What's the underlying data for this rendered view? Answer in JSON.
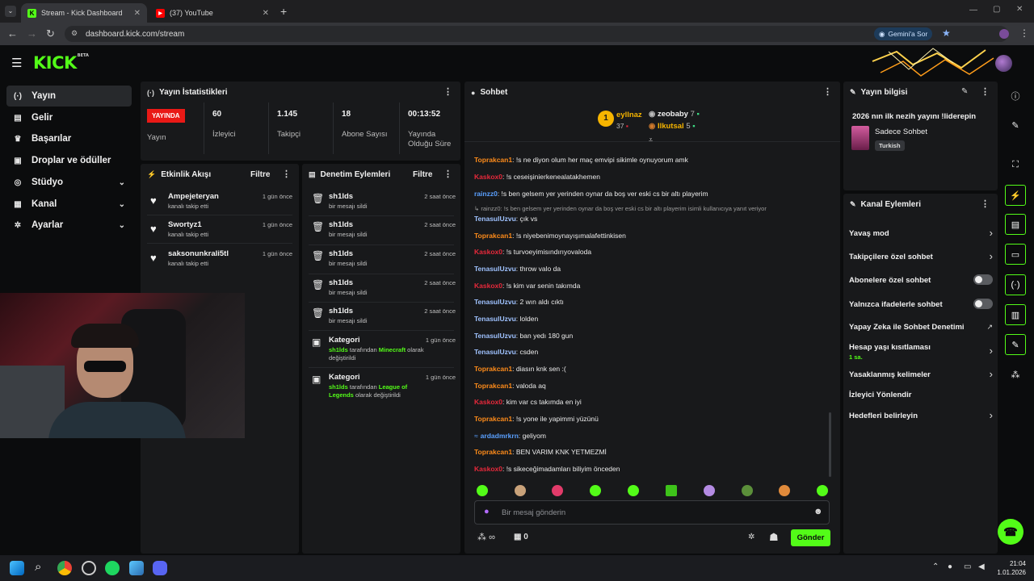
{
  "browser": {
    "tabs": [
      {
        "title": "Stream - Kick Dashboard"
      },
      {
        "title": "(37) YouTube"
      }
    ],
    "url": "dashboard.kick.com/stream",
    "gemini_label": "Gemini'a Sor"
  },
  "header": {
    "logo": "KICK",
    "logo_badge": "BETA"
  },
  "nav": {
    "items": [
      {
        "label": "Yayın",
        "icon": "broadcast-icon",
        "glyph": "(·)"
      },
      {
        "label": "Gelir",
        "icon": "revenue-icon",
        "glyph": "▤"
      },
      {
        "label": "Başarılar",
        "icon": "trophy-icon",
        "glyph": "♛"
      },
      {
        "label": "Droplar ve ödüller",
        "icon": "gift-icon",
        "glyph": "▣"
      },
      {
        "label": "Stüdyo",
        "icon": "studio-icon",
        "glyph": "◎"
      },
      {
        "label": "Kanal",
        "icon": "channel-icon",
        "glyph": "▦"
      },
      {
        "label": "Ayarlar",
        "icon": "settings-icon",
        "glyph": "✲"
      }
    ]
  },
  "stats": {
    "title": "Yayın İstatistikleri",
    "live_badge": "YAYINDA",
    "live_label": "Yayın",
    "items": [
      {
        "value": "60",
        "label": "İzleyici"
      },
      {
        "value": "1.145",
        "label": "Takipçi"
      },
      {
        "value": "18",
        "label": "Abone Sayısı"
      },
      {
        "value": "00:13:52",
        "label": "Yayında Olduğu Süre"
      }
    ]
  },
  "activity": {
    "title": "Etkinlik Akışı",
    "filter": "Filtre",
    "items": [
      {
        "name": "Ampejeteryan",
        "sub": "kanalı takip etti",
        "time": "1 gün önce"
      },
      {
        "name": "Swortyz1",
        "sub": "kanalı takip etti",
        "time": "1 gün önce"
      },
      {
        "name": "saksonunkrali5tl",
        "sub": "kanalı takip etti",
        "time": "1 gün önce"
      }
    ]
  },
  "moderation": {
    "title": "Denetim Eylemleri",
    "filter": "Filtre",
    "items": [
      {
        "name": "sh1lds",
        "sub": "bir mesajı sildi",
        "time": "2 saat önce"
      },
      {
        "name": "sh1lds",
        "sub": "bir mesajı sildi",
        "time": "2 saat önce"
      },
      {
        "name": "sh1lds",
        "sub": "bir mesajı sildi",
        "time": "2 saat önce"
      },
      {
        "name": "sh1lds",
        "sub": "bir mesajı sildi",
        "time": "2 saat önce"
      },
      {
        "name": "sh1lds",
        "sub": "bir mesajı sildi",
        "time": "2 saat önce"
      }
    ],
    "category_items": [
      {
        "name": "Kategori",
        "user": "sh1lds",
        "mid": "tarafından",
        "game": "Minecraft",
        "tail": "olarak değiştirildi",
        "time": "1 gün önce"
      },
      {
        "name": "Kategori",
        "user": "sh1lds",
        "mid": "tarafından",
        "game": "League of Legends",
        "tail": "olarak değiştirildi",
        "time": "1 gün önce"
      }
    ]
  },
  "chat": {
    "title": "Sohbet",
    "leaderboard": {
      "first": {
        "rank": "1",
        "name": "eyllnaz",
        "count": "37"
      },
      "second": {
        "name": "zeobaby",
        "count": "7"
      },
      "third": {
        "name": "Ilkutsal",
        "count": "5"
      }
    },
    "messages": [
      {
        "user": "Toprakcan1",
        "text": ": !s ne diyon olum her maç emvipi sikimle oynuyorum amk",
        "color": "#ff8c1a"
      },
      {
        "user": "Kaskox0",
        "text": ": !s ceseişinierkenealatakhemen",
        "color": "#e8293b"
      },
      {
        "user": "rainzz0",
        "text": ": !s ben gelsem yer yerinden oynar da boş ver eski cs bir altı playerim",
        "color": "#5aa0ff"
      },
      {
        "user": "TenasulUzvu",
        "text": ": çık vs",
        "color": "#9fc2ff"
      },
      {
        "user": "Toprakcan1",
        "text": ": !s niyebenimoynayışımalafettinkisen",
        "color": "#ff8c1a"
      },
      {
        "user": "Kaskox0",
        "text": ": !s turvoeyimisındırıyovaloda",
        "color": "#e8293b"
      },
      {
        "user": "TenasulUzvu",
        "text": ": throw valo da",
        "color": "#9fc2ff"
      },
      {
        "user": "Kaskox0",
        "text": ": !s kim var senin takımda",
        "color": "#e8293b"
      },
      {
        "user": "TenasulUzvu",
        "text": ": 2 wın aldı cıktı",
        "color": "#9fc2ff"
      },
      {
        "user": "TenasulUzvu",
        "text": ": lolden",
        "color": "#9fc2ff"
      },
      {
        "user": "TenasulUzvu",
        "text": ": ban yedı 180 gun",
        "color": "#9fc2ff"
      },
      {
        "user": "TenasulUzvu",
        "text": ": csden",
        "color": "#9fc2ff"
      },
      {
        "user": "Toprakcan1",
        "text": ": diasın knk sen :(",
        "color": "#ff8c1a"
      },
      {
        "user": "Toprakcan1",
        "text": ": valoda aq",
        "color": "#ff8c1a"
      },
      {
        "user": "Kaskox0",
        "text": ": kim var cs takımda en iyi",
        "color": "#e8293b"
      },
      {
        "user": "Toprakcan1",
        "text": ": !s yone ile yapimmi yüzünü",
        "color": "#ff8c1a"
      },
      {
        "user": "ardadmrkrn",
        "text": ": geliyom",
        "color": "#5aa0ff"
      },
      {
        "user": "Toprakcan1",
        "text": ": BEN VARIM KNK YETMEZMİ",
        "color": "#ff8c1a"
      },
      {
        "user": "Kaskox0",
        "text": ": !s sikeceğimadamları biliyim önceden",
        "color": "#e8293b"
      }
    ],
    "reply_context": "↳ rainzz0: !s ben gelsem yer yerinden oynar da boş ver eski cs bir altı playerim isimli kullanıcıya yanıt veriyor",
    "input_placeholder": "Bir mesaj gönderin",
    "points": "∞",
    "vault_count": "0",
    "send_label": "Gönder"
  },
  "stream_info": {
    "title": "Yayın bilgisi",
    "stream_title": "2026 nın ilk nezih yayını !liderepin",
    "category": "Sadece Sohbet",
    "language": "Turkish"
  },
  "channel_actions": {
    "title": "Kanal Eylemleri",
    "items": [
      {
        "label": "Yavaş mod",
        "type": "chevron"
      },
      {
        "label": "Takipçilere özel sohbet",
        "type": "chevron"
      },
      {
        "label": "Abonelere özel sohbet",
        "type": "toggle"
      },
      {
        "label": "Yalnızca ifadelerle sohbet",
        "type": "toggle"
      },
      {
        "label": "Yapay Zeka ile Sohbet Denetimi",
        "type": "external"
      },
      {
        "label": "Hesap yaşı kısıtlaması",
        "sub": "1 sa.",
        "type": "chevron"
      },
      {
        "label": "Yasaklanmış kelimeler",
        "type": "chevron"
      },
      {
        "label": "İzleyici Yönlendir",
        "type": "none"
      },
      {
        "label": "Hedefleri belirleyin",
        "type": "chevron"
      }
    ]
  },
  "taskbar": {
    "time": "21:04",
    "date": "1.01.2026"
  },
  "colors": {
    "accent": "#53fc18",
    "live": "#e91916",
    "panel": "#18191b"
  }
}
